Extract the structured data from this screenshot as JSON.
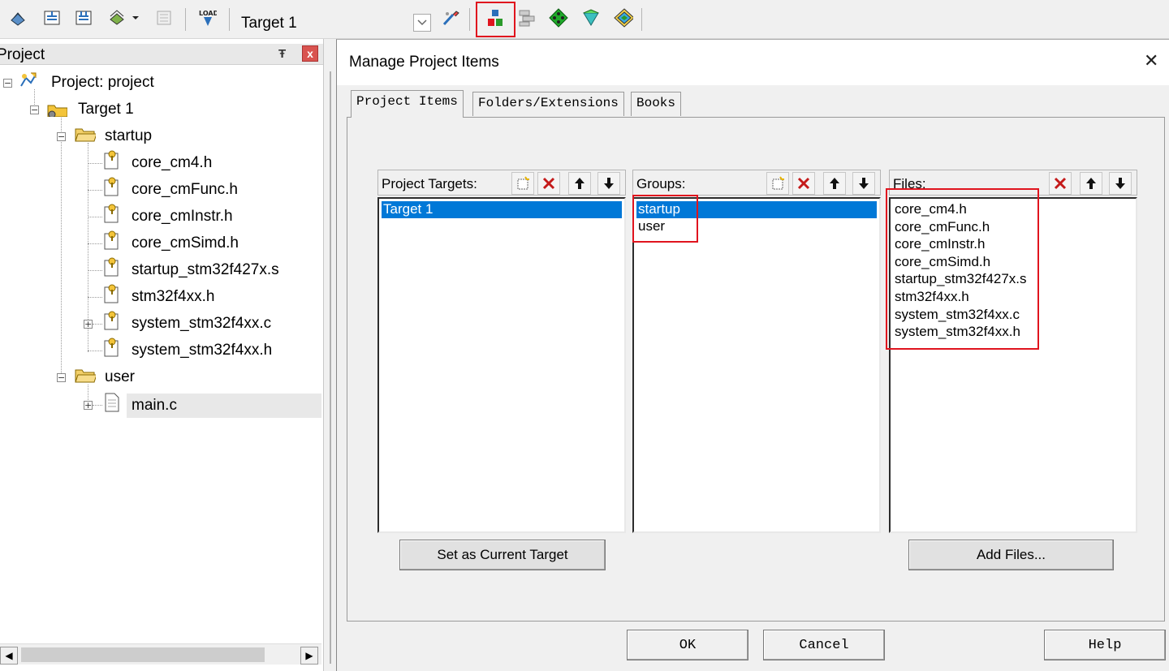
{
  "toolbar": {
    "target_label": "Target 1",
    "icons": [
      "translate-icon",
      "build-icon",
      "rebuild-icon",
      "batch-build-icon",
      "stop-build-icon",
      "download-icon",
      "target-options-icon",
      "manage-project-items-icon",
      "select-packs-icon",
      "manage-runtime-icon",
      "pack-installer-icon",
      "multi-project-icon"
    ]
  },
  "project_panel": {
    "title": "Project",
    "pin": "ᵖ",
    "close": "x",
    "tree": {
      "root": "Project: project",
      "target": "Target 1",
      "groups": [
        {
          "name": "startup",
          "files": [
            "core_cm4.h",
            "core_cmFunc.h",
            "core_cmInstr.h",
            "core_cmSimd.h",
            "startup_stm32f427x.s",
            "stm32f4xx.h",
            "system_stm32f4xx.c",
            "system_stm32f4xx.h"
          ]
        },
        {
          "name": "user",
          "files": [
            "main.c"
          ]
        }
      ]
    }
  },
  "dialog": {
    "title": "Manage Project Items",
    "close": "✕",
    "tabs": [
      "Project Items",
      "Folders/Extensions",
      "Books"
    ],
    "targets": {
      "label": "Project Targets:",
      "items": [
        "Target 1"
      ],
      "selected": 0
    },
    "groups": {
      "label": "Groups:",
      "items": [
        "startup",
        "user"
      ],
      "selected": 0
    },
    "files": {
      "label": "Files:",
      "items": [
        "core_cm4.h",
        "core_cmFunc.h",
        "core_cmInstr.h",
        "core_cmSimd.h",
        "startup_stm32f427x.s",
        "stm32f4xx.h",
        "system_stm32f4xx.c",
        "system_stm32f4xx.h"
      ]
    },
    "buttons": {
      "set_current": "Set as Current Target",
      "add_files": "Add Files...",
      "ok": "OK",
      "cancel": "Cancel",
      "help": "Help"
    }
  },
  "colors": {
    "selection": "#0078d7",
    "highlight_box": "#e0141e"
  }
}
